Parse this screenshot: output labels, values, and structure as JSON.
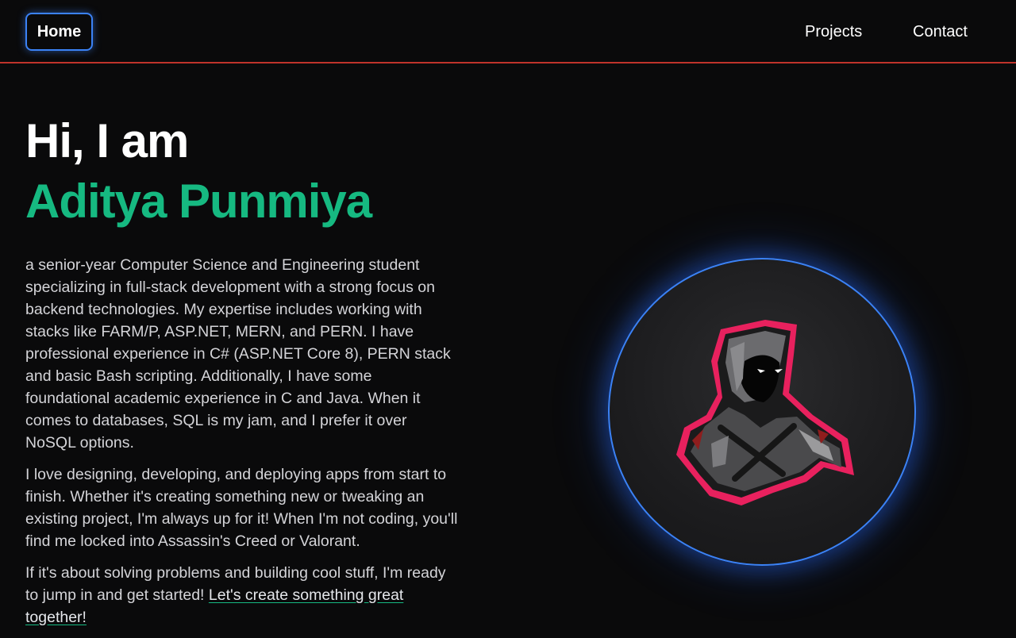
{
  "nav": {
    "home_label": "Home",
    "projects_label": "Projects",
    "contact_label": "Contact"
  },
  "hero": {
    "greeting": "Hi, I am",
    "name": "Aditya Punmiya",
    "paragraph_1": "a senior-year Computer Science and Engineering student specializing in full-stack development with a strong focus on backend technologies. My expertise includes working with stacks like FARM/P, ASP.NET, MERN, and PERN. I have professional experience in C# (ASP.NET Core 8), PERN stack and basic Bash scripting. Additionally, I have some foundational academic experience in C and Java. When it comes to databases, SQL is my jam, and I prefer it over NoSQL options.",
    "paragraph_2": "I love designing, developing, and deploying apps from start to finish. Whether it's creating something new or tweaking an existing project, I'm always up for it! When I'm not coding, you'll find me locked into Assassin's Creed or Valorant.",
    "paragraph_3_prefix": "If it's about solving problems and building cool stuff, I'm ready to jump in and get started! ",
    "paragraph_3_link": "Let's create something great together!"
  },
  "avatar": {
    "icon": "hooded-assassin-avatar-icon"
  },
  "colors": {
    "background": "#0a0a0b",
    "accent_green": "#16b981",
    "accent_blue": "#3b82f6",
    "divider_red": "#c0332b",
    "avatar_outline_pink": "#e8215e"
  }
}
